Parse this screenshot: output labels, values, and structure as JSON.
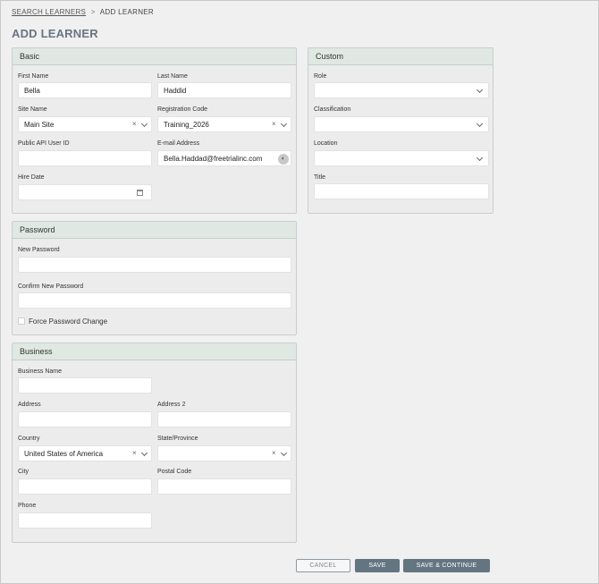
{
  "breadcrumb": {
    "parent": "SEARCH LEARNERS",
    "separator": ">",
    "current": "ADD LEARNER"
  },
  "page_title": "ADD LEARNER",
  "basic": {
    "title": "Basic",
    "first_name": {
      "label": "First Name",
      "value": "Bella"
    },
    "last_name": {
      "label": "Last Name",
      "value": "Haddid"
    },
    "site_name": {
      "label": "Site Name",
      "value": "Main Site"
    },
    "registration_code": {
      "label": "Registration Code",
      "value": "Training_2026"
    },
    "public_api_user_id": {
      "label": "Public API User ID",
      "value": ""
    },
    "email": {
      "label": "E-mail Address",
      "value": "Bella.Haddad@freetrialinc.com"
    },
    "hire_date": {
      "label": "Hire Date",
      "value": ""
    }
  },
  "custom": {
    "title": "Custom",
    "role": {
      "label": "Role",
      "value": ""
    },
    "classification": {
      "label": "Classification",
      "value": ""
    },
    "location": {
      "label": "Location",
      "value": ""
    },
    "job_title": {
      "label": "Title",
      "value": ""
    }
  },
  "password": {
    "title": "Password",
    "new_password": {
      "label": "New Password",
      "value": ""
    },
    "confirm_password": {
      "label": "Confirm New Password",
      "value": ""
    },
    "force_change": {
      "label": "Force Password Change",
      "checked": false
    }
  },
  "business": {
    "title": "Business",
    "business_name": {
      "label": "Business Name",
      "value": ""
    },
    "address": {
      "label": "Address",
      "value": ""
    },
    "address2": {
      "label": "Address 2",
      "value": ""
    },
    "country": {
      "label": "Country",
      "value": "United States of America"
    },
    "state": {
      "label": "State/Province",
      "value": ""
    },
    "city": {
      "label": "City",
      "value": ""
    },
    "postal_code": {
      "label": "Postal Code",
      "value": ""
    },
    "phone": {
      "label": "Phone",
      "value": ""
    }
  },
  "buttons": {
    "cancel": "CANCEL",
    "save": "SAVE",
    "save_continue": "SAVE & CONTINUE"
  },
  "icons": {
    "clear": "×",
    "calendar": "calendar-icon",
    "contact_card": "contact-card-icon"
  },
  "colors": {
    "panel_header": "#dfe8e2",
    "primary_button": "#637580",
    "title": "#6a7480"
  }
}
